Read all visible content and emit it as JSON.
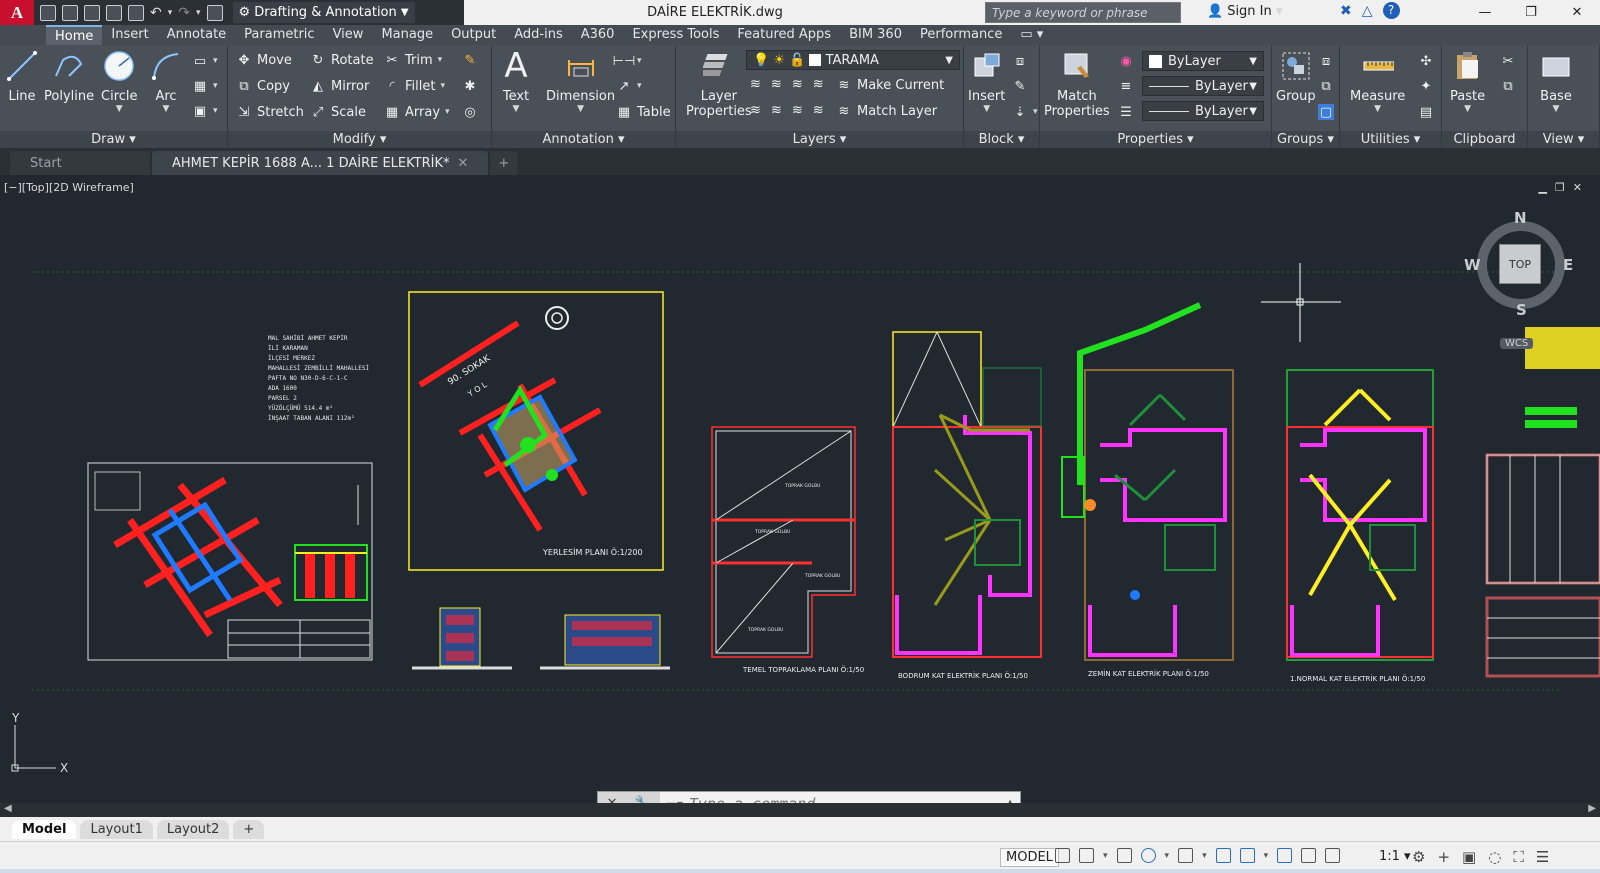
{
  "titlebar": {
    "logo": "A",
    "workspace": "Drafting & Annotation",
    "doc_title": "DAİRE ELEKTRİK.dwg",
    "search_placeholder": "Type a keyword or phrase",
    "signin": "Sign In",
    "help": "?"
  },
  "ribbon_tabs": [
    "Home",
    "Insert",
    "Annotate",
    "Parametric",
    "View",
    "Manage",
    "Output",
    "Add-ins",
    "A360",
    "Express Tools",
    "Featured Apps",
    "BIM 360",
    "Performance"
  ],
  "ribbon": {
    "draw": {
      "title": "Draw",
      "line": "Line",
      "polyline": "Polyline",
      "circle": "Circle",
      "arc": "Arc"
    },
    "modify": {
      "title": "Modify",
      "move": "Move",
      "rotate": "Rotate",
      "trim": "Trim",
      "copy": "Copy",
      "mirror": "Mirror",
      "fillet": "Fillet",
      "stretch": "Stretch",
      "scale": "Scale",
      "array": "Array"
    },
    "annotation": {
      "title": "Annotation",
      "text": "Text",
      "dimension": "Dimension",
      "table": "Table"
    },
    "layers": {
      "title": "Layers",
      "layer_properties_1": "Layer",
      "layer_properties_2": "Properties",
      "current_layer": "TARAMA",
      "make_current": "Make Current",
      "match_layer": "Match Layer"
    },
    "block": {
      "title": "Block",
      "insert": "Insert"
    },
    "properties": {
      "title": "Properties",
      "match_1": "Match",
      "match_2": "Properties",
      "color": "ByLayer",
      "linetype": "ByLayer",
      "lineweight": "ByLayer"
    },
    "groups": {
      "title": "Groups",
      "group": "Group"
    },
    "utilities": {
      "title": "Utilities",
      "measure": "Measure"
    },
    "clipboard": {
      "title": "Clipboard",
      "paste": "Paste"
    },
    "view": {
      "title": "View",
      "base": "Base"
    }
  },
  "doc_tabs": {
    "start": "Start",
    "active": "AHMET KEPİR 1688 A... 1 DAİRE ELEKTRİK*",
    "plus": "+"
  },
  "viewport": {
    "label": "[−][Top][2D Wireframe]",
    "viewcube": {
      "top": "TOP",
      "n": "N",
      "s": "S",
      "e": "E",
      "w": "W"
    },
    "wcs": "WCS",
    "ucs_x": "X",
    "ucs_y": "Y"
  },
  "drawing_labels": {
    "info_block": [
      "MAL SAHİBİ AHMET KEPİR",
      "İLİ KARAMAN",
      "İLÇESİ MERKEZ",
      "MAHALLESİ ZEMBİLLİ MAHALLESİ",
      "PAFTA NO N30-D-6-C-1-C",
      "ADA 1600",
      "PARSEL 2",
      "YÜZÖLÇÜMÜ 514.4 m²",
      "İNŞAAT TABAN ALANI 112m²"
    ],
    "street": "90. SOKAK",
    "yol": "Y O L",
    "yerlesim": "YERLESİM PLANI  Ö:1/200",
    "temel": "TEMEL TOPRAKLAMA PLANI Ö:1/50",
    "bodrum": "BODRUM  KAT  ELEKTRİK PLANI Ö:1/50",
    "zemin": "ZEMİN  KAT ELEKTRİK PLANI Ö:1/50",
    "normal": "1.NORMAL KAT ELEKTRİK PLANI Ö:1/50",
    "toprak": "TOPRAK GOLBU"
  },
  "command": {
    "placeholder": "Type a command"
  },
  "layout_tabs": [
    "Model",
    "Layout1",
    "Layout2",
    "+"
  ],
  "status": {
    "model": "MODEL",
    "scale": "1:1"
  },
  "colors": {
    "red": "#ff1a1a",
    "blue": "#1e7bff",
    "green": "#22e11e",
    "yellow": "#ffee22",
    "magenta": "#ff33ff",
    "olive": "#9a9a1a",
    "darkgreen": "#1f8f3a"
  }
}
